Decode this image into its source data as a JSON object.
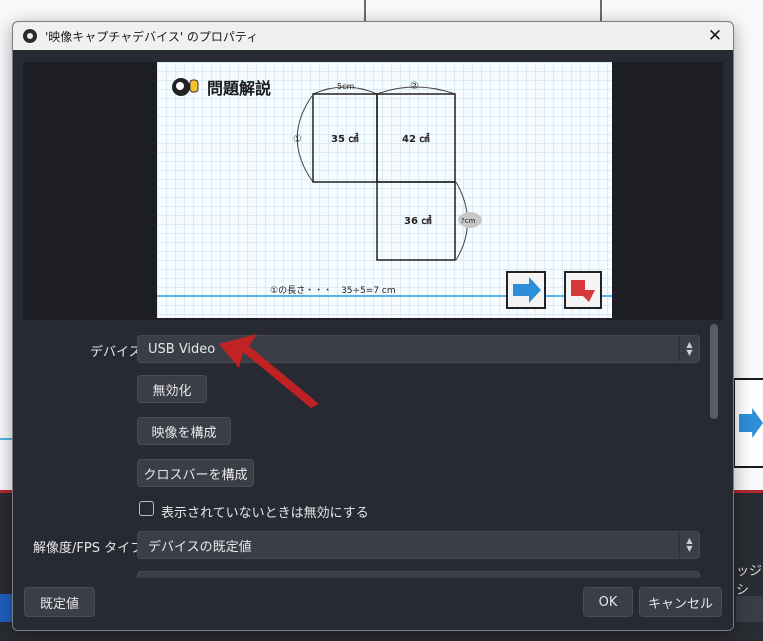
{
  "dialog": {
    "title": "'映像キャプチャデバイス' のプロパティ",
    "close_glyph": "✕"
  },
  "preview": {
    "heading": "問題解説",
    "top_label_a": "5cm",
    "top_label_b": "②",
    "left_label": "①",
    "cell_a": "35 ㎠",
    "cell_b": "42 ㎠",
    "cell_c": "36 ㎠",
    "side_label": "?cm",
    "formula": "①の長さ・・・　35÷5=7 cm",
    "accent_blue": "#2d8fd8",
    "accent_red": "#d63a3a"
  },
  "form": {
    "device_label": "デバイス",
    "device_value": "USB Video",
    "disable_button": "無効化",
    "configure_video_button": "映像を構成",
    "configure_crossbar_button": "クロスバーを構成",
    "deactivate_checkbox_label": "表示されていないときは無効にする",
    "deactivate_checked": false,
    "resolution_label": "解像度/FPS タイプ",
    "resolution_value": "デバイスの既定値"
  },
  "footer": {
    "defaults_button": "既定値",
    "ok_button": "OK",
    "cancel_button": "キャンセル"
  },
  "background": {
    "right_text": "ッジシ",
    "annotation_color": "#d01f1f"
  }
}
